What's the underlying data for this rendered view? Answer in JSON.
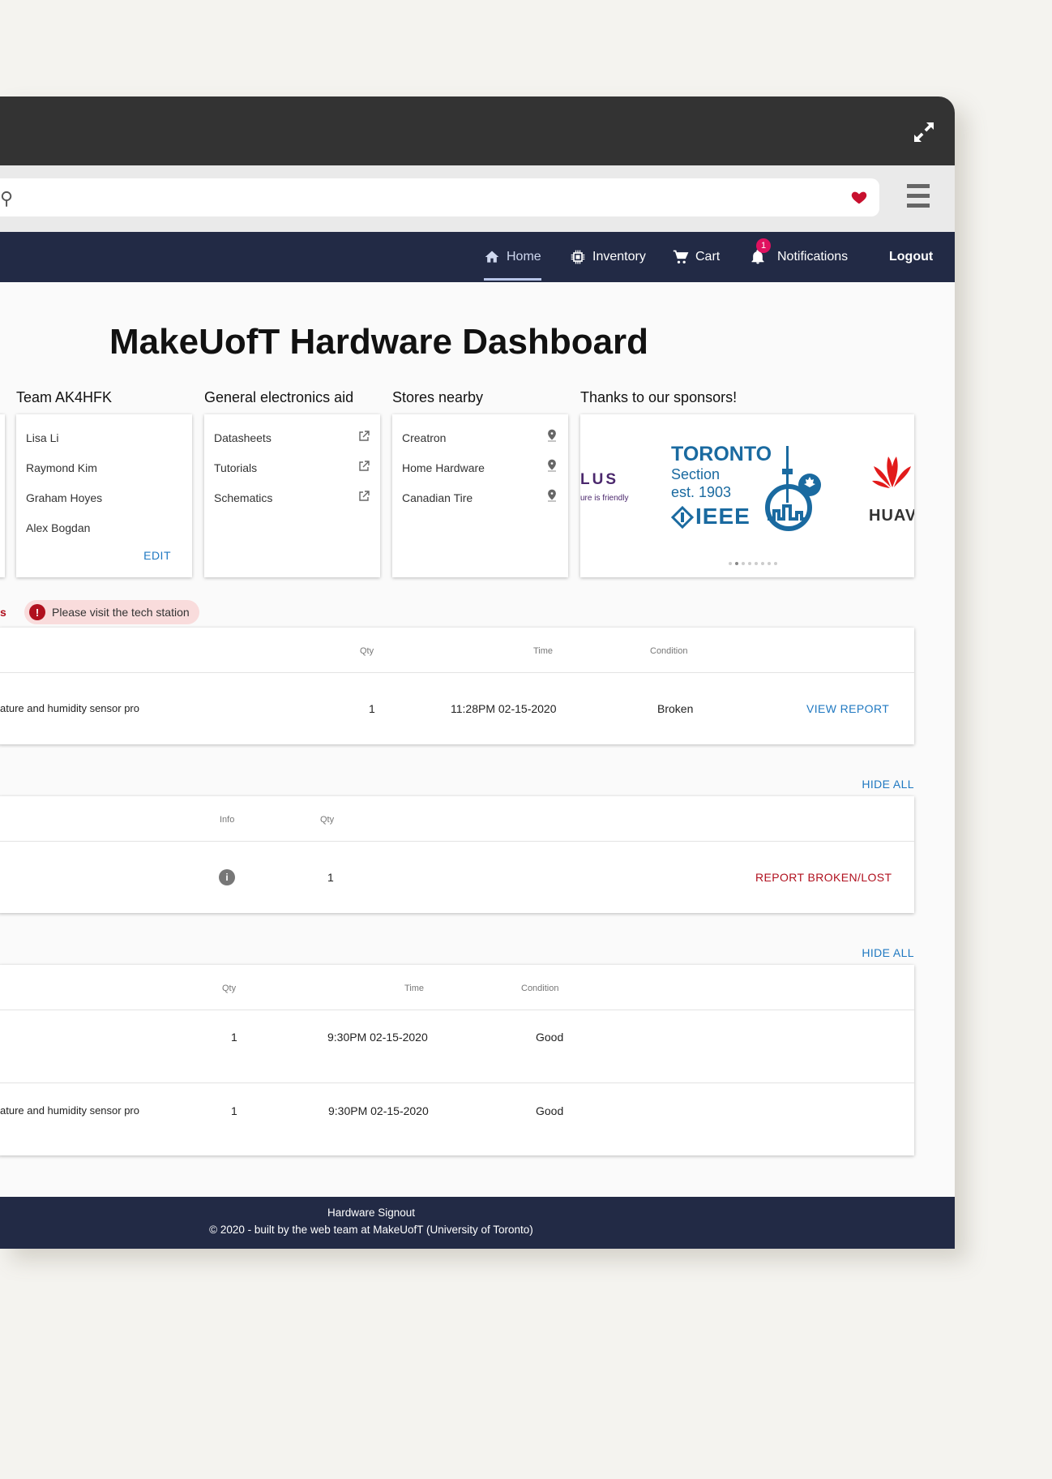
{
  "window": {
    "accent_navbar": "#222a45",
    "accent_link": "#1f78c1",
    "accent_error": "#b0101e"
  },
  "nav": {
    "home": "Home",
    "inventory": "Inventory",
    "cart": "Cart",
    "notifications": "Notifications",
    "notification_count": "1",
    "logout": "Logout"
  },
  "page_title": "MakeUofT Hardware Dashboard",
  "team": {
    "heading": "Team AK4HFK",
    "members": [
      "Lisa Li",
      "Raymond Kim",
      "Graham Hoyes",
      "Alex Bogdan"
    ],
    "edit": "EDIT"
  },
  "electronics": {
    "heading": "General electronics aid",
    "links": [
      "Datasheets",
      "Tutorials",
      "Schematics"
    ]
  },
  "stores": {
    "heading": "Stores nearby",
    "items": [
      "Creatron",
      "Home Hardware",
      "Canadian Tire"
    ]
  },
  "sponsors": {
    "heading": "Thanks to our sponsors!",
    "telus_text": "LUS",
    "telus_tagline": "ure is friendly",
    "ieee_line1": "TORONTO",
    "ieee_line2": "Section",
    "ieee_line3": "est. 1903",
    "ieee_line4": "IEEE",
    "huawei_text": "HUAV"
  },
  "broken": {
    "trunc_label": "s",
    "alert": "Please visit the tech station",
    "headers": {
      "qty": "Qty",
      "time": "Time",
      "condition": "Condition"
    },
    "rows": [
      {
        "name": "ature and humidity sensor pro",
        "qty": "1",
        "time": "11:28PM 02-15-2020",
        "condition": "Broken",
        "action": "VIEW REPORT"
      }
    ]
  },
  "checked_out": {
    "hide_all": "HIDE ALL",
    "headers": {
      "info": "Info",
      "qty": "Qty"
    },
    "rows": [
      {
        "qty": "1",
        "action": "REPORT BROKEN/LOST"
      }
    ]
  },
  "returned": {
    "hide_all": "HIDE ALL",
    "headers": {
      "qty": "Qty",
      "time": "Time",
      "condition": "Condition"
    },
    "rows": [
      {
        "name": "",
        "qty": "1",
        "time": "9:30PM 02-15-2020",
        "condition": "Good"
      },
      {
        "name": "ature and humidity sensor pro",
        "qty": "1",
        "time": "9:30PM 02-15-2020",
        "condition": "Good"
      }
    ]
  },
  "footer": {
    "line1": "Hardware Signout",
    "line2": "© 2020 - built by the web team at MakeUofT (University of Toronto)"
  }
}
